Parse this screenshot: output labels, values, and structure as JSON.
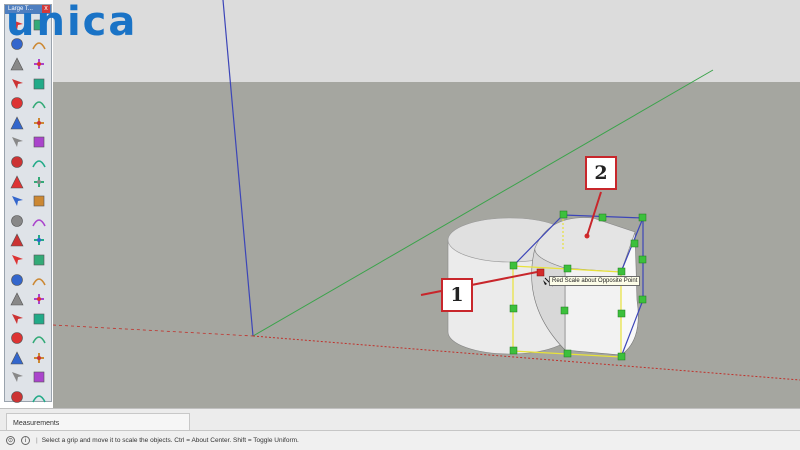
{
  "logo": {
    "text": "unica",
    "color": "#1a73c6"
  },
  "toolbar": {
    "title": "Large T...",
    "close_label": "x",
    "tools": [
      "select-icon",
      "eraser-icon",
      "paint-bucket-icon",
      "eraser2-icon",
      "line-icon",
      "freehand-icon",
      "rectangle-icon",
      "rotated-rectangle-icon",
      "circle-icon",
      "polygon-icon",
      "arc-icon",
      "arc2-icon",
      "pie-icon",
      "three-point-arc-icon",
      "move-icon",
      "push-pull-icon",
      "rotate-icon",
      "follow-me-icon",
      "scale-icon",
      "offset-icon",
      "tape-measure-icon",
      "dimension-icon",
      "protractor-icon",
      "text-icon",
      "axes-icon",
      "3d-text-icon",
      "orbit-icon",
      "pan-icon",
      "zoom-icon",
      "zoom-window-icon",
      "zoom-extents-icon",
      "previous-view-icon",
      "position-camera-icon",
      "walk-icon",
      "look-around-icon",
      "section-plane-icon",
      "components-icon",
      "materials-icon",
      "warehouse-icon",
      "extension-icon"
    ]
  },
  "viewport": {
    "tooltip": "Red Scale about Opposite Point",
    "callouts": [
      "1",
      "2"
    ],
    "colors": {
      "red_axis": "#c0302a",
      "green_axis": "#3aa34a",
      "blue_axis": "#3c45b8",
      "grip": "#3cc03c",
      "bbox": "#e8e23a",
      "callout_border": "#c8262b"
    }
  },
  "measurements": {
    "label": "Measurements"
  },
  "status": {
    "text": "Select a grip and move it to scale the objects. Ctrl = About Center. Shift = Toggle Uniform."
  }
}
